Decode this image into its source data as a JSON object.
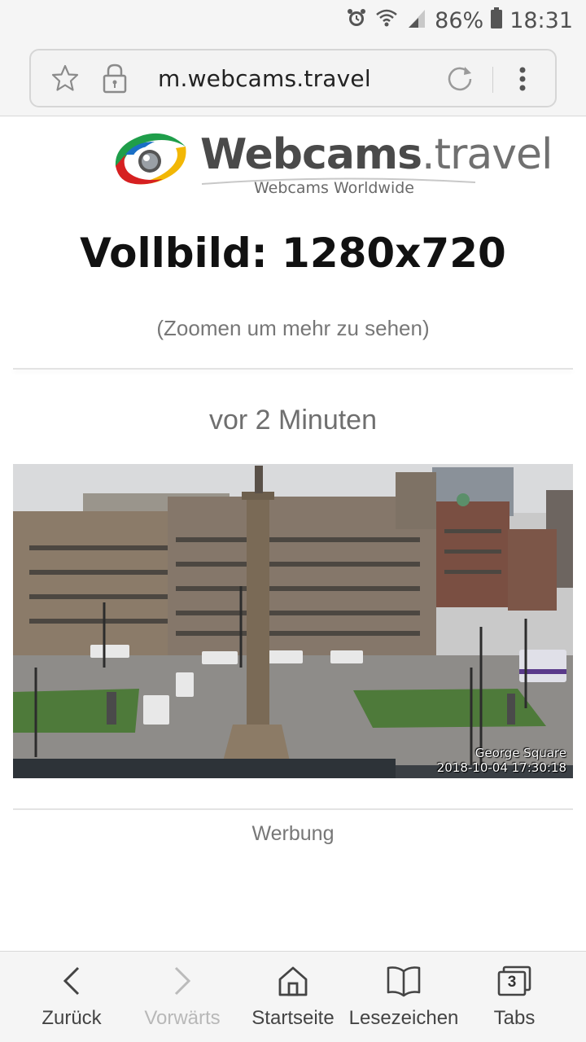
{
  "status_bar": {
    "battery": "86%",
    "time": "18:31"
  },
  "browser": {
    "url": "m.webcams.travel"
  },
  "logo": {
    "brand_bold": "Webcams",
    "brand_light": ".travel",
    "tagline": "Webcams Worldwide"
  },
  "page": {
    "title": "Vollbild: 1280x720",
    "hint": "(Zoomen um mehr zu sehen)",
    "age": "vor 2 Minuten",
    "webcam_location": "George Square",
    "webcam_timestamp": "2018-10-04 17:30:18",
    "ad_label": "Werbung"
  },
  "bottom_nav": {
    "back": "Zurück",
    "forward": "Vorwärts",
    "home": "Startseite",
    "bookmarks": "Lesezeichen",
    "tabs": "Tabs",
    "tab_count": "3"
  }
}
